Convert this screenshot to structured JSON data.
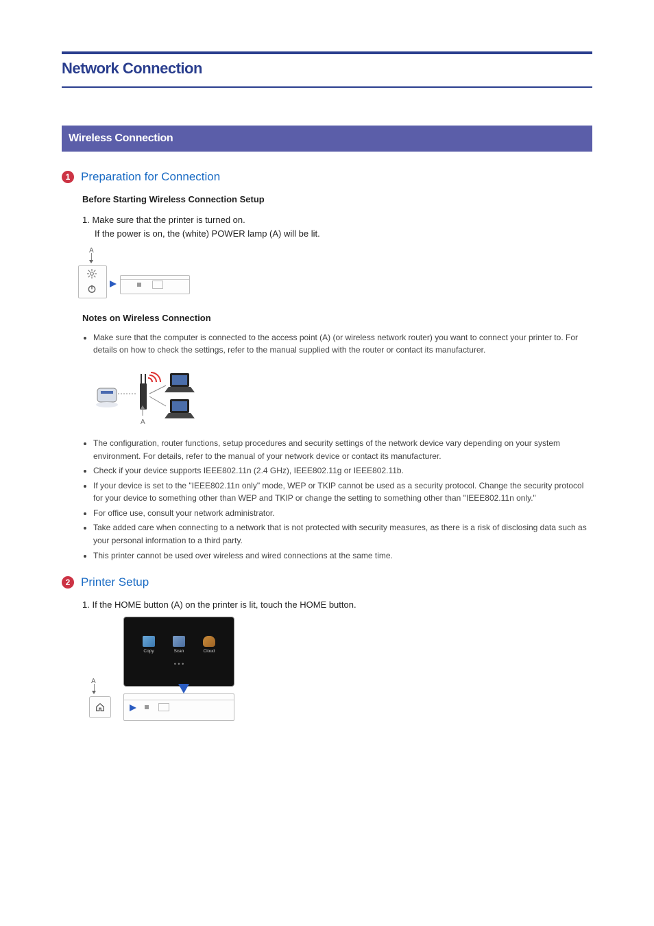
{
  "title": "Network Connection",
  "banner": "Wireless Connection",
  "step1": {
    "num": "1",
    "title": "Preparation for Connection",
    "before_heading": "Before Starting Wireless Connection Setup",
    "line1": "1.  Make sure that the printer is turned on.",
    "line1b": "If the power is on, the (white) POWER lamp (A) will be lit.",
    "label_a": "A",
    "notes_heading": "Notes on Wireless Connection",
    "notes": [
      "Make sure that the computer is connected to the access point (A) (or wireless network router) you want to connect your printer to. For details on how to check the settings, refer to the manual supplied with the router or contact its manufacturer.",
      "The configuration, router functions, setup procedures and security settings of the network device vary depending on your system environment. For details, refer to the manual of your network device or contact its manufacturer.",
      "Check if your device supports IEEE802.11n (2.4 GHz), IEEE802.11g or IEEE802.11b.",
      "If your device is set to the \"IEEE802.11n only\" mode, WEP or TKIP cannot be used as a security protocol. Change the security protocol for your device to something other than WEP and TKIP or change the setting to something other than \"IEEE802.11n only.\"",
      "For office use, consult your network administrator.",
      "Take added care when connecting to a network that is not protected with security measures, as there is a risk of disclosing data such as your personal information to a third party.",
      "This printer cannot be used over wireless and wired connections at the same time."
    ]
  },
  "step2": {
    "num": "2",
    "title": "Printer Setup",
    "line1": "1.  If the HOME button (A) on the printer is lit, touch the HOME button.",
    "label_a": "A",
    "apps": {
      "copy": "Copy",
      "scan": "Scan",
      "cloud": "Cloud"
    }
  },
  "diagram_net_a": "A"
}
